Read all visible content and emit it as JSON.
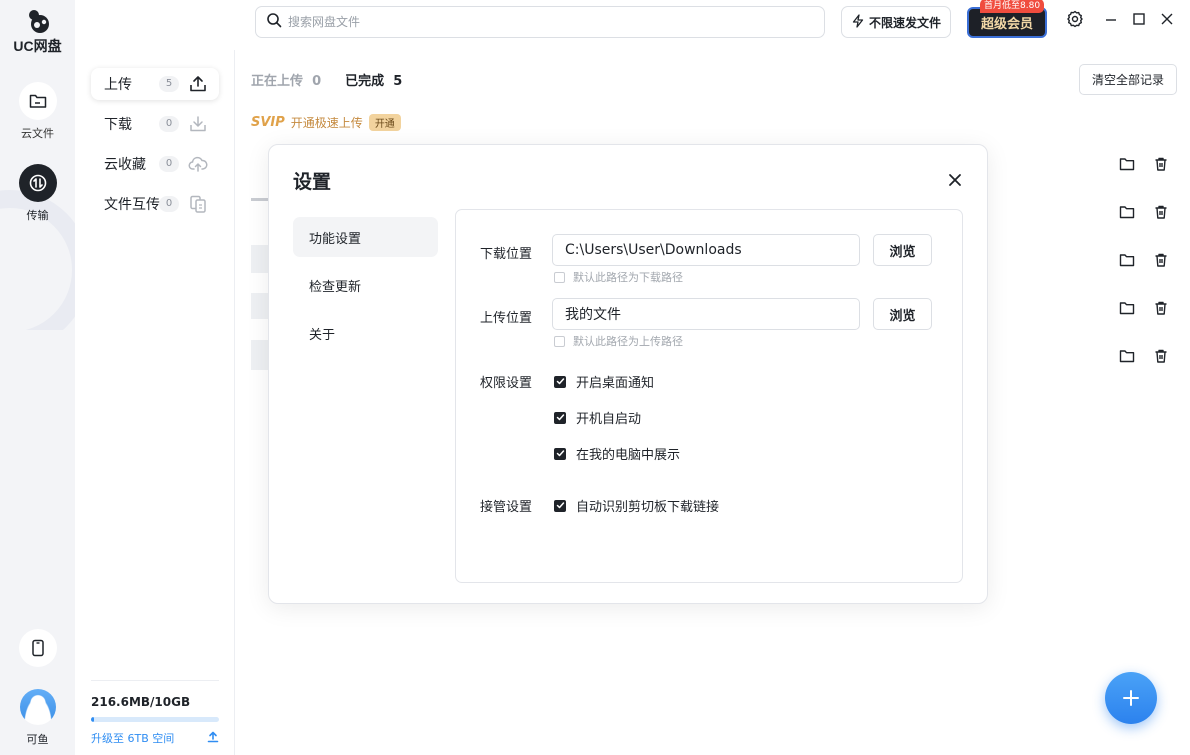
{
  "app": {
    "logo_text": "UC网盘"
  },
  "rail": {
    "items": [
      {
        "label": "云文件",
        "icon": "folder-icon"
      },
      {
        "label": "传输",
        "icon": "transfer-icon"
      }
    ],
    "user_name": "可鱼"
  },
  "nav": {
    "items": [
      {
        "label": "上传",
        "count": "5",
        "icon": "upload-icon"
      },
      {
        "label": "下载",
        "count": "0",
        "icon": "download-icon"
      },
      {
        "label": "云收藏",
        "count": "0",
        "icon": "cloud-upload-icon"
      },
      {
        "label": "文件互传",
        "count": "0",
        "icon": "file-transfer-icon"
      }
    ]
  },
  "storage": {
    "usage_text": "216.6MB/10GB",
    "used_fraction": 0.02,
    "upgrade_text": "升级至 6TB 空间"
  },
  "topbar": {
    "search_placeholder": "搜索网盘文件",
    "speed_label": "不限速发文件",
    "vip_label": "超级会员",
    "vip_badge": "首月低至8.80"
  },
  "main": {
    "tab_uploading": "正在上传",
    "tab_uploading_count": "0",
    "tab_done": "已完成",
    "tab_done_count": "5",
    "clear_label": "清空全部记录",
    "svip_logo": "SVIP",
    "svip_text": "开通极速上传",
    "svip_open": "开通"
  },
  "dialog": {
    "title": "设置",
    "nav": [
      "功能设置",
      "检查更新",
      "关于"
    ],
    "download_label": "下载位置",
    "download_path": "C:\\Users\\User\\Downloads",
    "download_default": "默认此路径为下载路径",
    "upload_label": "上传位置",
    "upload_path": "我的文件",
    "upload_default": "默认此路径为上传路径",
    "browse_label": "浏览",
    "permission_label": "权限设置",
    "permissions": [
      "开启桌面通知",
      "开机自启动",
      "在我的电脑中展示"
    ],
    "takeover_label": "接管设置",
    "takeover_option": "自动识别剪切板下载链接"
  },
  "colors": {
    "accent": "#2f8df2",
    "vip_bg": "#1d2027",
    "vip_text": "#f3d8a7",
    "badge": "#f04c3e"
  }
}
